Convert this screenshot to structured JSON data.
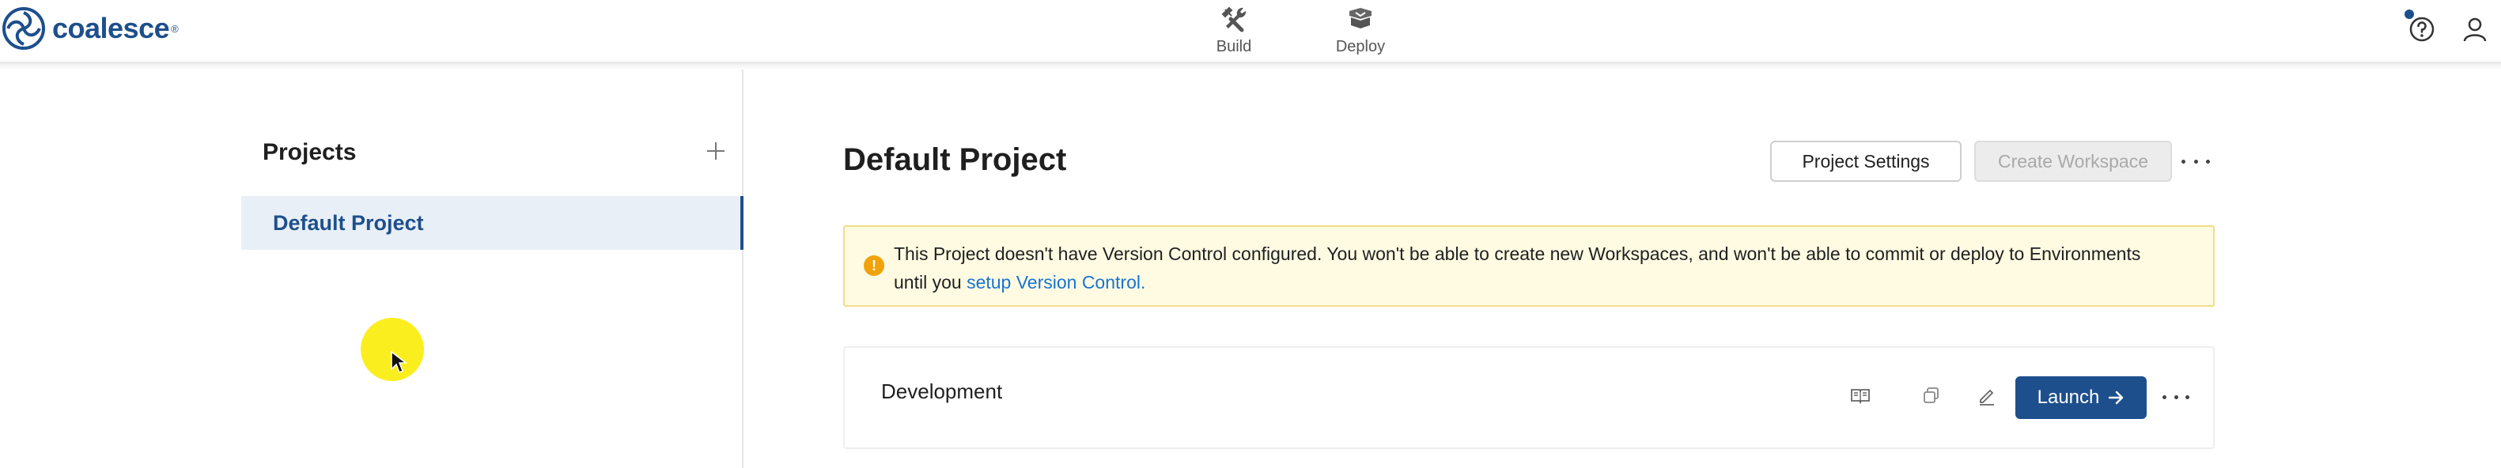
{
  "app": {
    "logo_text": "coalesce",
    "logo_mark": "®"
  },
  "nav": {
    "items": [
      {
        "label": "Build",
        "icon": "tools-icon"
      },
      {
        "label": "Deploy",
        "icon": "deploy-icon"
      }
    ]
  },
  "header_icons": {
    "help": "help-icon",
    "user": "user-icon",
    "notification_color": "#1d4f8c"
  },
  "sidebar": {
    "heading": "Projects",
    "add_icon": "plus-icon",
    "items": [
      {
        "label": "Default Project",
        "selected": true
      }
    ]
  },
  "main": {
    "title": "Default Project",
    "buttons": {
      "project_settings": "Project Settings",
      "create_workspace": "Create Workspace",
      "create_workspace_disabled": true
    },
    "alert": {
      "icon": "!",
      "text": "This Project doesn't have Version Control configured. You won't be able to create new Workspaces, and won't be able to commit or deploy to Environments until you",
      "link": "setup Version Control."
    },
    "environments": [
      {
        "name": "Development",
        "launch_label": "Launch"
      }
    ]
  },
  "colors": {
    "brand": "#1d4f8c",
    "alert_background": "#fffbe3",
    "alert_border": "#f1dd8c",
    "alert_icon": "#f0a20b",
    "link": "#1874d0",
    "selected_background": "#e9eff7"
  }
}
